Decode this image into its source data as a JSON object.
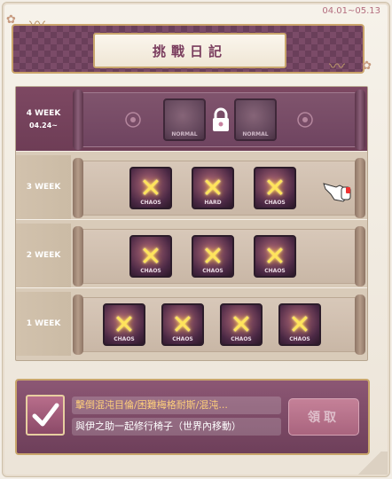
{
  "date_range": "04.01~05.13",
  "title": "挑戰日記",
  "weeks": [
    {
      "label": "4 WEEK",
      "sub": "04.24~",
      "locked": true,
      "stages": [
        {
          "tag": "NORMAL",
          "cleared": false
        },
        {
          "tag": "NORMAL",
          "cleared": false
        }
      ]
    },
    {
      "label": "3 WEEK",
      "locked": false,
      "stages": [
        {
          "tag": "CHAOS",
          "cleared": true
        },
        {
          "tag": "HARD",
          "cleared": true
        },
        {
          "tag": "CHAOS",
          "cleared": true
        }
      ]
    },
    {
      "label": "2 WEEK",
      "locked": false,
      "stages": [
        {
          "tag": "CHAOS",
          "cleared": true
        },
        {
          "tag": "CHAOS",
          "cleared": true
        },
        {
          "tag": "CHAOS",
          "cleared": true
        }
      ]
    },
    {
      "label": "1 WEEK",
      "locked": false,
      "stages": [
        {
          "tag": "CHAOS",
          "cleared": true
        },
        {
          "tag": "CHAOS",
          "cleared": true
        },
        {
          "tag": "CHAOS",
          "cleared": true
        },
        {
          "tag": "CHAOS",
          "cleared": true
        }
      ]
    }
  ],
  "reward": {
    "line1": "擊倒混沌目倫/困難梅格耐斯/混沌...",
    "line2": "與伊之助一起修行椅子（世界內移動）",
    "claim_label": "領取"
  },
  "colors": {
    "accent": "#7a3d5e",
    "gold_border": "#c9a66c",
    "clear_mark": "#ffe45c"
  },
  "icons": {
    "lock": "lock-icon",
    "clear": "x-mark-icon",
    "cursor": "pointing-hand-icon",
    "reward": "checkmark-icon"
  }
}
